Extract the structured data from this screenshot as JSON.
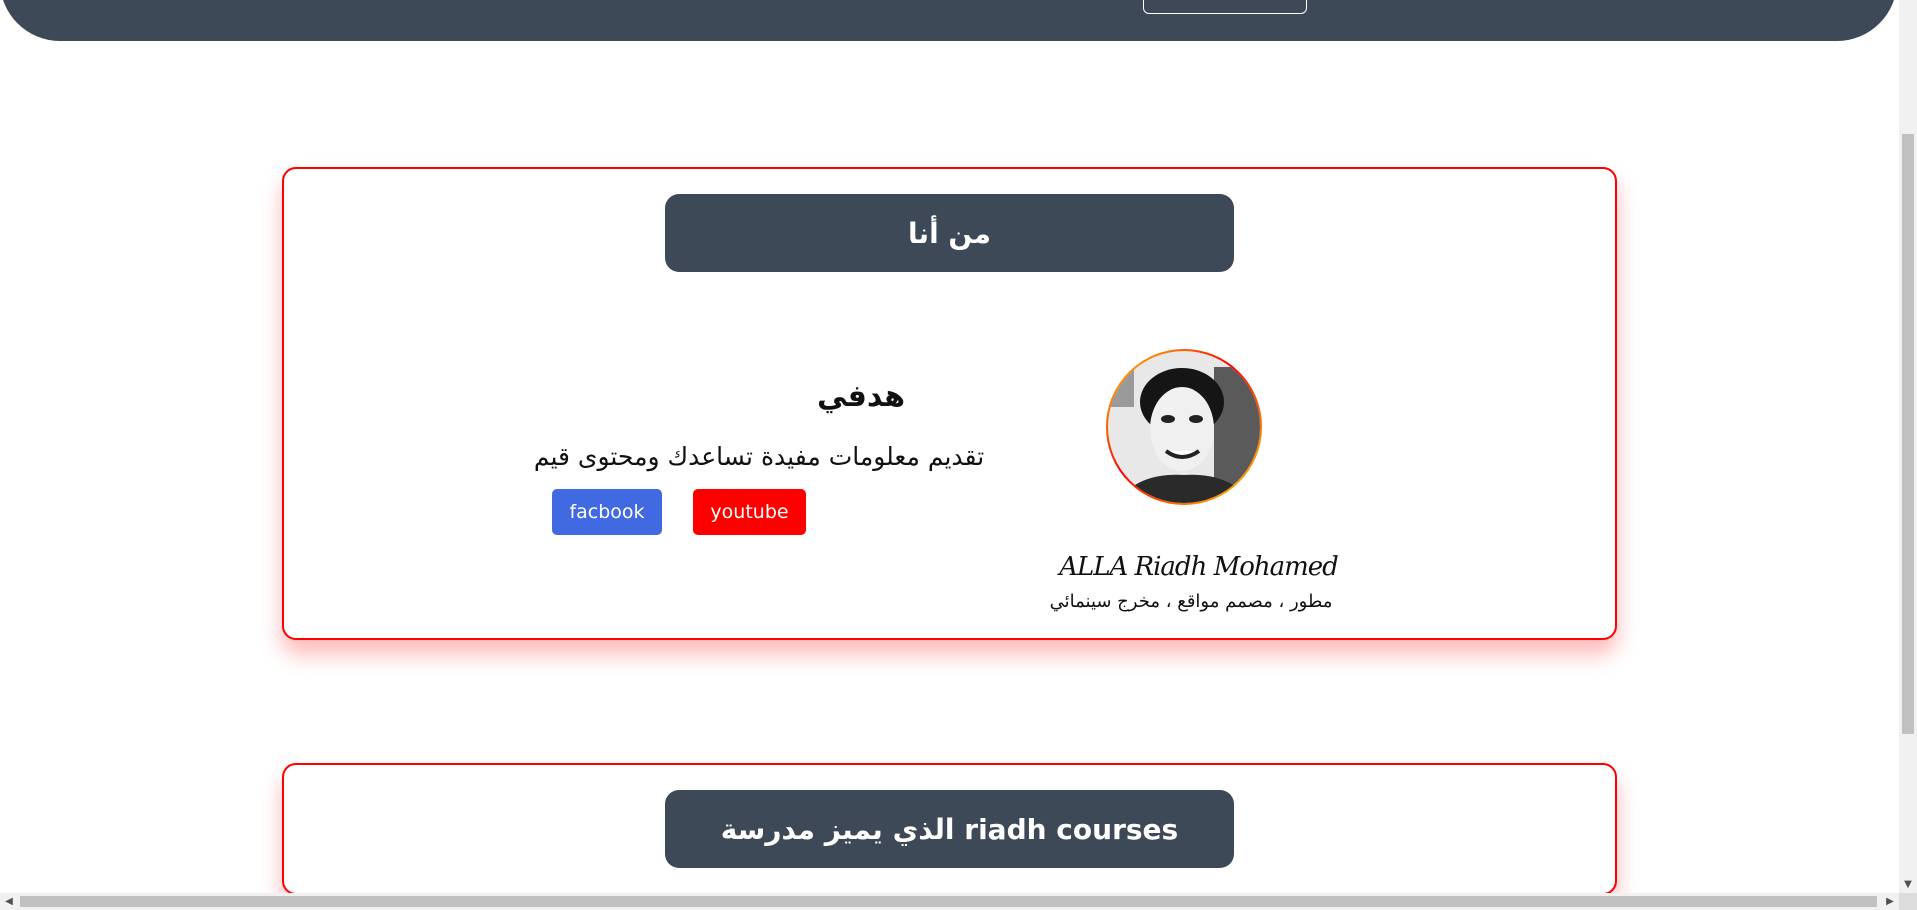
{
  "header": {
    "button_label": ""
  },
  "about": {
    "title": "من أنا",
    "name": "ALLA Riadh Mohamed",
    "role": "مطور ، مصمم مواقع ، مخرج سينمائي",
    "goal_title": "هدفي",
    "goal_text": "تقديم معلومات مفيدة تساعدك ومحتوى قيم",
    "facebook_label": "facbook",
    "youtube_label": "youtube"
  },
  "features": {
    "title": "الذي يميز مدرسة riadh courses"
  },
  "colors": {
    "header_bg": "#3e4957",
    "card_border": "#ff0000",
    "facebook": "#4169e1",
    "youtube": "#ff0000"
  },
  "icons": {
    "scroll_up": "chevron-up-icon",
    "scroll_down": "chevron-down-icon",
    "scroll_left": "chevron-left-icon",
    "scroll_right": "chevron-right-icon"
  }
}
